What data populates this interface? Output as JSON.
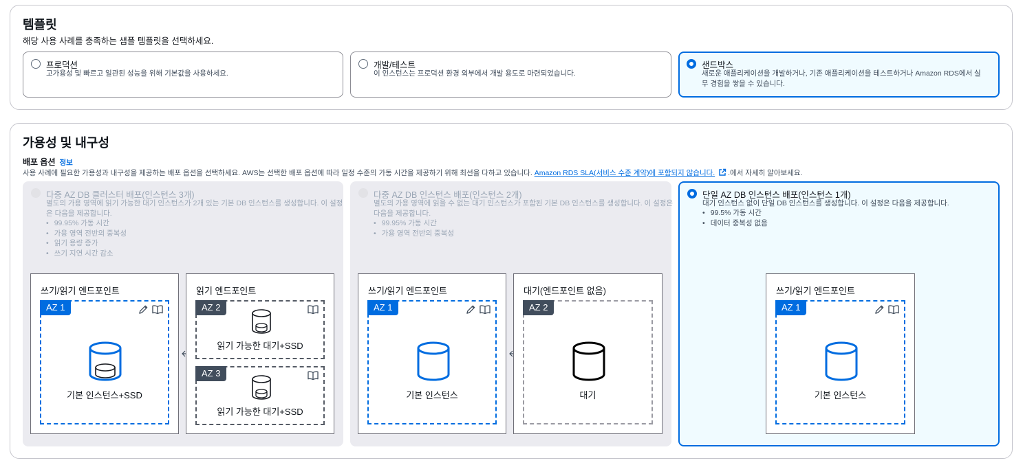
{
  "templates": {
    "title": "템플릿",
    "description": "해당 사용 사례를 충족하는 샘플 템플릿을 선택하세요.",
    "options": [
      {
        "label": "프로덕션",
        "description": "고가용성 및 빠르고 일관된 성능을 위해 기본값을 사용하세요."
      },
      {
        "label": "개발/테스트",
        "description": "이 인스턴스는 프로덕션 환경 외부에서 개발 용도로 마련되었습니다."
      },
      {
        "label": "샌드박스",
        "description_line1": "새로운 애플리케이션을 개발하거나, 기존 애플리케이션을 테스트하거나 Amazon RDS에서 실",
        "description_line2": "무 경험을 쌓을 수 있습니다."
      }
    ],
    "selected": "샌드박스"
  },
  "availability": {
    "title": "가용성 및 내구성",
    "deployment_heading": "배포 옵션",
    "info_link": "정보",
    "description_prefix": "사용 사례에 필요한 가용성과 내구성을 제공하는 배포 옵션을 선택하세요. AWS는 선택한 배포 옵션에 따라 일정 수준의 가동 시간을 제공하기 위해 최선을 다하고 있습니다. ",
    "sla_link": "Amazon RDS SLA(서비스 수준 계약)에 포함되지 않습니다.",
    "description_suffix": ".에서 자세히 알아보세요.",
    "options": [
      {
        "title": "다중 AZ DB 클러스터 배포(인스턴스 3개)",
        "text": "별도의 가용 영역에 읽기 가능한 대기 인스턴스가 2개 있는 기본 DB 인스턴스를 생성합니다. 이 설정은 다음을 제공합니다.",
        "bullets": [
          "99.95% 가동 시간",
          "가용 영역 전반의 중복성",
          "읽기 용량 증가",
          "쓰기 지연 시간 감소"
        ],
        "diagram": {
          "rw_endpoint": "쓰기/읽기 엔드포인트",
          "read_endpoint": "읽기 엔드포인트",
          "az1": "AZ 1",
          "az2": "AZ 2",
          "az3": "AZ 3",
          "primary_label": "기본 인스턴스+SSD",
          "standby_label_1": "읽기 가능한 대기+SSD",
          "standby_label_2": "읽기 가능한 대기+SSD"
        }
      },
      {
        "title": "다중 AZ DB 인스턴스 배포(인스턴스 2개)",
        "text": "별도의 가용 영역에 읽을 수 없는 대기 인스턴스가 포함된 기본 DB 인스턴스를 생성합니다. 이 설정은 다음을 제공합니다.",
        "bullets": [
          "99.95% 가동 시간",
          "가용 영역 전반의 중복성"
        ],
        "diagram": {
          "rw_endpoint": "쓰기/읽기 엔드포인트",
          "standby_endpoint": "대기(엔드포인트 없음)",
          "az1": "AZ 1",
          "az2": "AZ 2",
          "primary_label": "기본 인스턴스",
          "standby_label": "대기"
        }
      },
      {
        "title": "단일 AZ DB 인스턴스 배포(인스턴스 1개)",
        "text": "대기 인스턴스 없이 단일 DB 인스턴스를 생성합니다. 이 설정은 다음을 제공합니다.",
        "bullets": [
          "99.5% 가동 시간",
          "데이터 중복성 없음"
        ],
        "diagram": {
          "rw_endpoint": "쓰기/읽기 엔드포인트",
          "az1": "AZ 1",
          "primary_label": "기본 인스턴스"
        }
      }
    ],
    "selected": "단일 AZ DB 인스턴스 배포(인스턴스 1개)"
  },
  "colors": {
    "accent": "#006ce0",
    "selected_bg": "#f0fbff",
    "disabled_bg": "#ebebf0",
    "az_dark": "#414d5c"
  }
}
